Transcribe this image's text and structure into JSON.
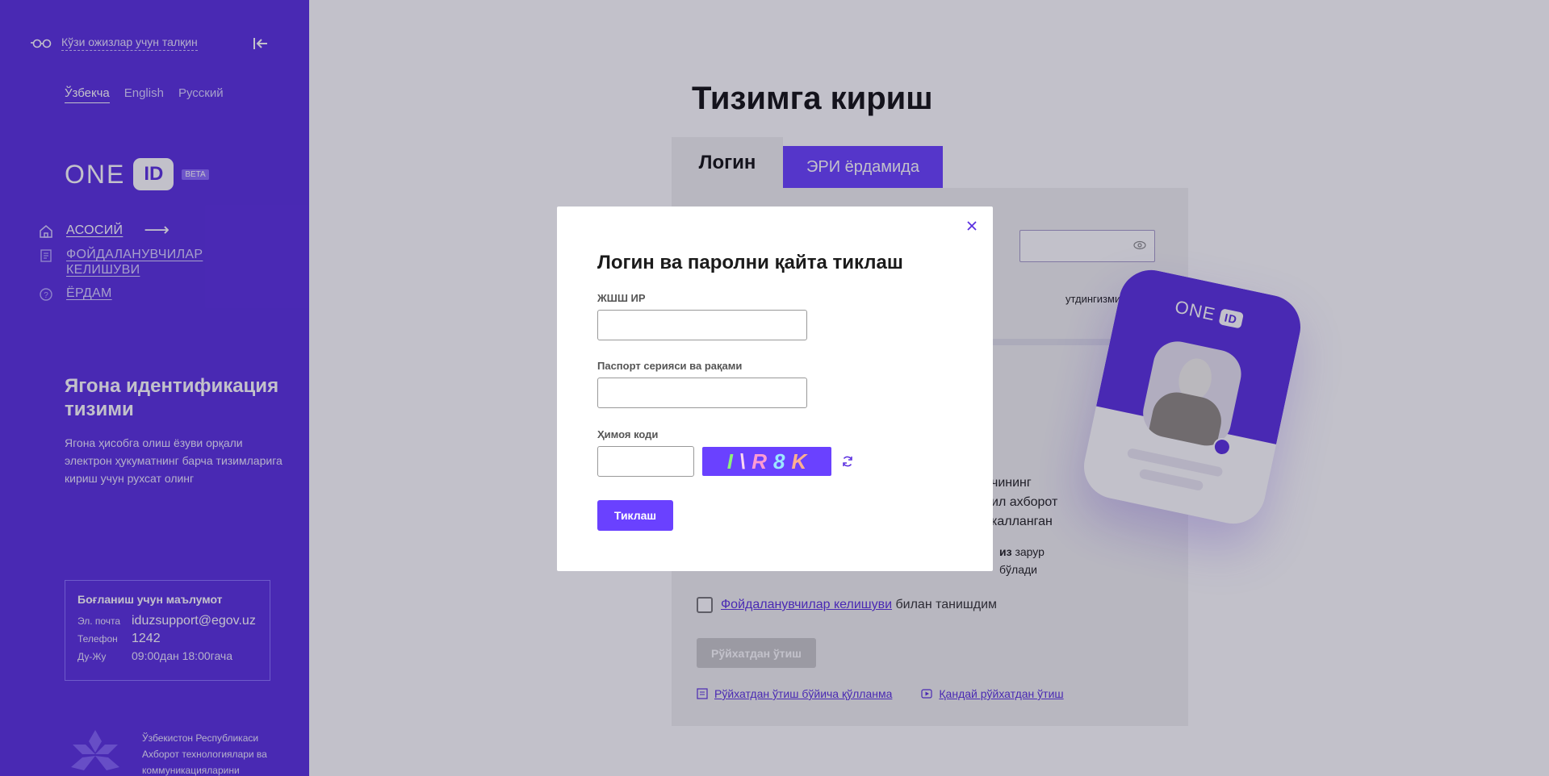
{
  "sidebar": {
    "accessibility_label": "Кўзи ожизлар учун талқин",
    "languages": [
      "Ўзбекча",
      "English",
      "Русский"
    ],
    "active_language": "Ўзбекча",
    "logo": {
      "text": "ONE",
      "badge": "ID",
      "beta": "BETA"
    },
    "nav": [
      {
        "label": "АСОСИЙ",
        "icon": "home-icon"
      },
      {
        "label": "ФОЙДАЛАНУВЧИЛАР КЕЛИШУВИ",
        "icon": "document-icon"
      },
      {
        "label": "ЁРДАМ",
        "icon": "help-icon"
      }
    ],
    "system_title": "Ягона идентификация тизими",
    "system_description": "Ягона ҳисобга олиш ёзуви орқали электрон ҳукуматнинг барча тизимларига кириш учун рухсат олинг",
    "contact": {
      "title": "Боғланиш учун маълумот",
      "email_label": "Эл. почта",
      "email": "iduzsupport@egov.uz",
      "phone_label": "Телефон",
      "phone": "1242",
      "hours_label": "Ду-Жу",
      "hours": "09:00дан 18:00гача"
    },
    "ministry": "Ўзбекистон Республикаси Ахборот технологиялари ва коммуникацияларини"
  },
  "main": {
    "title": "Тизимга кириш",
    "tab_login": "Логин",
    "tab_eri": "ЭРИ ёрдамида",
    "forgot_fragment": "утдингизми?",
    "text_fragment_1": "чининг\nил ахборот\nкалланган",
    "text_fragment_2_bold": "из",
    "text_fragment_2": " зарур\nбўлади",
    "agree_link": "Фойдаланувчилар келишуви",
    "agree_text": "билан танишдим",
    "register_button": "Рўйхатдан ўтиш",
    "guide_manual": "Рўйхатдан ўтиш бўйича қўлланма",
    "guide_video": "Қандай рўйхатдан ўтиш",
    "card_logo_text": "ONE",
    "card_logo_badge": "ID"
  },
  "modal": {
    "title": "Логин ва паролни қайта тиклаш",
    "field_pinfl_label": "ЖШШ ИР",
    "field_pinfl_value": "",
    "field_passport_label": "Паспорт серияси ва рақами",
    "field_passport_value": "",
    "field_captcha_label": "Ҳимоя коди",
    "field_captcha_value": "",
    "captcha_chars": [
      "I",
      "\\",
      "R",
      "8",
      "K"
    ],
    "submit_label": "Тиклаш"
  },
  "colors": {
    "brand": "#5a2fe0",
    "accent": "#6a41ff",
    "overlay": "rgba(30,25,60,0.27)"
  }
}
